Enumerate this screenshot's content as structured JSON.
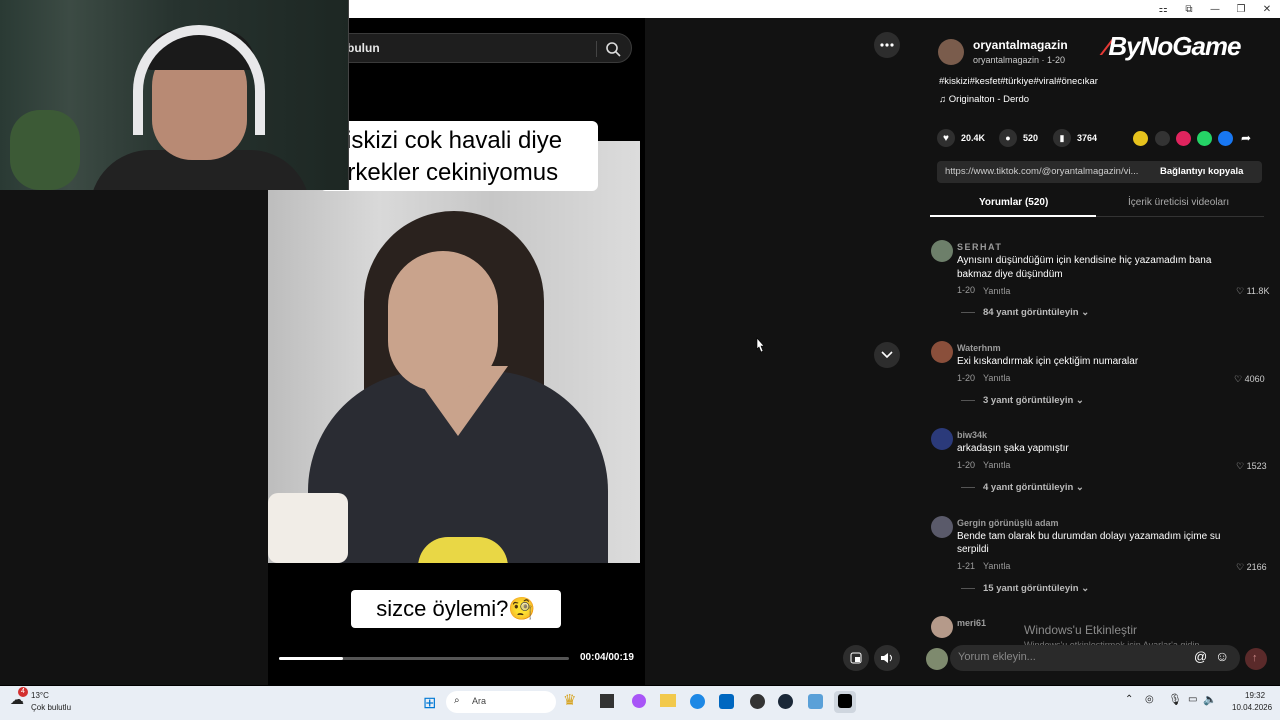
{
  "browser": {
    "controls": [
      "⚏",
      "⧉",
      "—",
      "❐",
      "✕"
    ]
  },
  "search": {
    "placeholder_text": "bulun"
  },
  "video": {
    "caption_top_line1": "kiskizi cok havali diye",
    "caption_top_line2": "erkekler cekiniyomus",
    "caption_bottom": "sizce öylemi?🧐",
    "time": "00:04/00:19",
    "progress": 0.22
  },
  "post": {
    "username": "oryantalmagazin",
    "subline": "oryantalmagazin · 1-20",
    "hashtags": "#kiskizi#kesfet#türkiye#viral#önecıkar",
    "music": "Originalton - Derdo",
    "likes": "20.4K",
    "comments": "520",
    "saves": "3764",
    "link": "https://www.tiktok.com/@oryantalmagazin/vi...",
    "copy_label": "Bağlantıyı kopyala",
    "tab_comments": "Yorumlar (520)",
    "tab_creator": "İçerik üreticisi videoları"
  },
  "logo_text": "ByNoGame",
  "comments": [
    {
      "user": "SERHAT",
      "text1": "Aynısını düşündüğüm için kendisine hiç yazamadım bana",
      "text2": "bakmaz diye düşündüm",
      "date": "1-20",
      "reply": "Yanıtla",
      "likes": "11.8K",
      "view": "84 yanıt görüntüleyin"
    },
    {
      "user": "Waterhnm",
      "text1": "Exi kıskandırmak için çektiğim numaralar",
      "text2": "",
      "date": "1-20",
      "reply": "Yanıtla",
      "likes": "4060",
      "view": "3 yanıt görüntüleyin"
    },
    {
      "user": "biw34k",
      "text1": "arkadaşın şaka yapmıştır",
      "text2": "",
      "date": "1-20",
      "reply": "Yanıtla",
      "likes": "1523",
      "view": "4 yanıt görüntüleyin"
    },
    {
      "user": "Gergin görünüşlü adam",
      "text1": "Bende tam olarak bu durumdan dolayı yazamadım içime su",
      "text2": "serpildi",
      "date": "1-21",
      "reply": "Yanıtla",
      "likes": "2166",
      "view": "15 yanıt görüntüleyin"
    },
    {
      "user": "meri61"
    }
  ],
  "comment_input": {
    "placeholder": "Yorum ekleyin..."
  },
  "windows": {
    "activate": "Windows'u Etkinleştir",
    "activate_sub": "Windows'u etkinleştirmek için Ayarlar'a gidin."
  },
  "taskbar": {
    "weather_temp": "13°C",
    "weather_desc": "Çok bulutlu",
    "weather_badge": "4",
    "search": "Ara",
    "time": "19:32",
    "date": "10.04.2026"
  }
}
